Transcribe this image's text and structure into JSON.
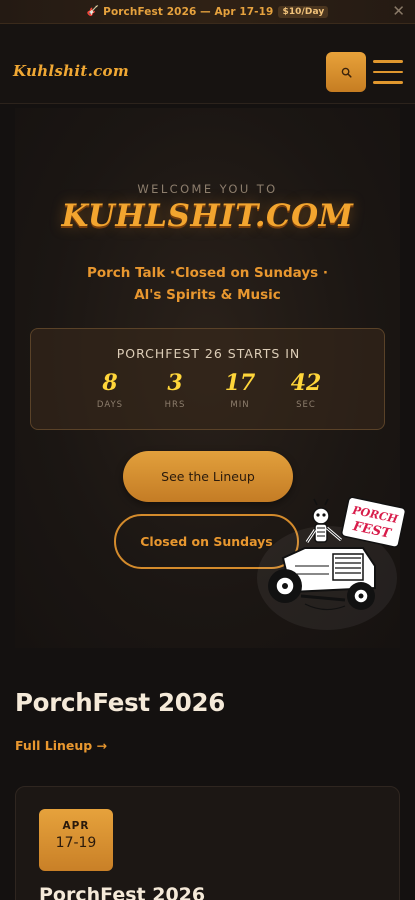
{
  "announcement": {
    "icon": "guitar-icon",
    "text": "PorchFest 2026 — Apr 17-19",
    "price_badge": "$10/Day",
    "close_icon": "close-icon"
  },
  "header": {
    "logo": "Kuhlshit.com",
    "search_icon": "search-icon",
    "menu_icon": "hamburger-menu-icon"
  },
  "hero": {
    "welcome": "WELCOME YOU TO",
    "title": "KUHLSHIT.COM",
    "tagline_line1": "Porch Talk ·Closed on Sundays ·",
    "tagline_line2": "Al's Spirits & Music",
    "countdown": {
      "title": "PORCHFEST 26 STARTS IN",
      "units": [
        {
          "value": "8",
          "label": "DAYS"
        },
        {
          "value": "3",
          "label": "HRS"
        },
        {
          "value": "17",
          "label": "MIN"
        },
        {
          "value": "42",
          "label": "SEC"
        }
      ]
    },
    "primary_button": "See the Lineup",
    "secondary_button": "Closed on Sundays",
    "sticker_text": [
      "PORCH",
      "FEST"
    ]
  },
  "section": {
    "title": "PorchFest 2026",
    "link": "Full Lineup →"
  },
  "event_card": {
    "month": "APR",
    "days": "17-19",
    "title": "PorchFest 2026"
  },
  "colors": {
    "accent": "#e8972f",
    "countdown_digits": "#ffd63a",
    "background": "#141110"
  }
}
